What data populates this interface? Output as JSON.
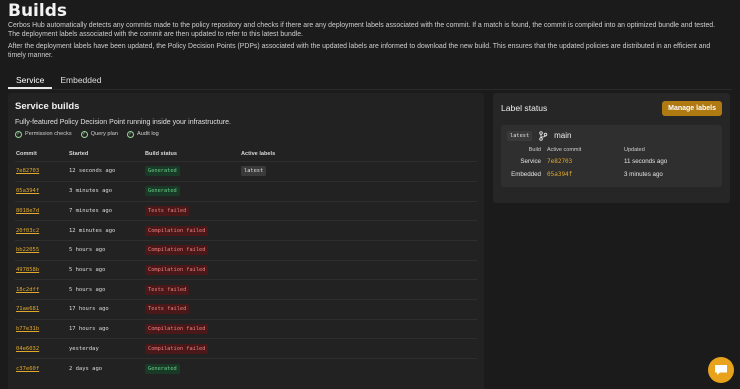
{
  "page": {
    "title": "Builds",
    "desc1": "Cerbos Hub automatically detects any commits made to the policy repository and checks if there are any deployment labels associated with the commit. If a match is found, the commit is compiled into an optimized bundle and tested. The deployment labels associated with the commit are then updated to refer to this latest bundle.",
    "desc2": "After the deployment labels have been updated, the Policy Decision Points (PDPs) associated with the updated labels are informed to download the new build. This ensures that the updated policies are distributed in an efficient and timely manner."
  },
  "tabs": [
    "Service",
    "Embedded"
  ],
  "service_builds": {
    "title": "Service builds",
    "subtitle": "Fully-featured Policy Decision Point running inside your infrastructure.",
    "features": [
      "Permission checks",
      "Query plan",
      "Audit log"
    ],
    "columns": [
      "Commit",
      "Started",
      "Build status",
      "Active labels"
    ],
    "rows": [
      {
        "commit": "7e82703",
        "started": "12 seconds ago",
        "status": "Generated",
        "label": "latest"
      },
      {
        "commit": "05a394f",
        "started": "3 minutes ago",
        "status": "Generated",
        "label": ""
      },
      {
        "commit": "8018e7d",
        "started": "7 minutes ago",
        "status": "Tests failed",
        "label": ""
      },
      {
        "commit": "20f03c2",
        "started": "12 minutes ago",
        "status": "Compilation failed",
        "label": ""
      },
      {
        "commit": "bb22055",
        "started": "5 hours ago",
        "status": "Compilation failed",
        "label": ""
      },
      {
        "commit": "497858b",
        "started": "5 hours ago",
        "status": "Compilation failed",
        "label": ""
      },
      {
        "commit": "18c2dff",
        "started": "5 hours ago",
        "status": "Tests failed",
        "label": ""
      },
      {
        "commit": "71ae681",
        "started": "17 hours ago",
        "status": "Tests failed",
        "label": ""
      },
      {
        "commit": "b77e31b",
        "started": "17 hours ago",
        "status": "Compilation failed",
        "label": ""
      },
      {
        "commit": "04e6032",
        "started": "yesterday",
        "status": "Compilation failed",
        "label": ""
      },
      {
        "commit": "c37e60f",
        "started": "2 days ago",
        "status": "Generated",
        "label": ""
      }
    ]
  },
  "label_status": {
    "title": "Label status",
    "manage_button": "Manage labels",
    "label": "latest",
    "branch": "main",
    "columns": [
      "Build",
      "Active commit",
      "Updated"
    ],
    "rows": [
      {
        "build": "Service",
        "commit": "7e82703",
        "updated": "11 seconds ago"
      },
      {
        "build": "Embedded",
        "commit": "05a394f",
        "updated": "3 minutes ago"
      }
    ]
  },
  "colors": {
    "accent": "#e0a92e",
    "success": "#6fd08f",
    "failure": "#f08080",
    "button": "#b07a12"
  },
  "icons": {
    "feature": "check-circle-icon",
    "branch": "git-branch-icon",
    "chat": "chat-bubble-icon"
  }
}
